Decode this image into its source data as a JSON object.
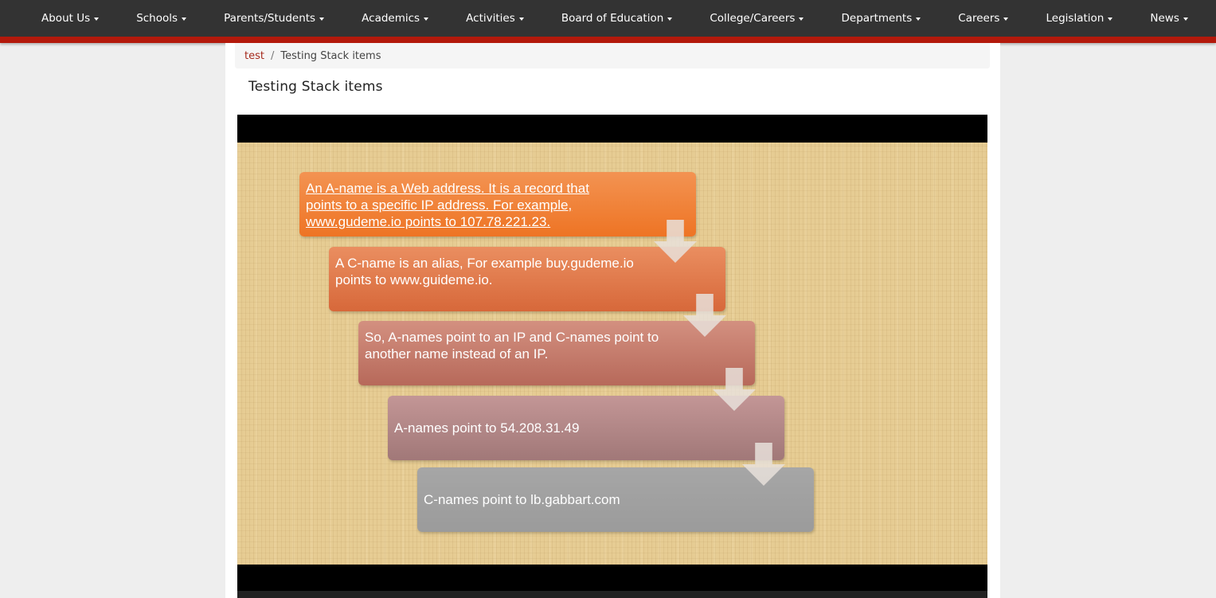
{
  "nav": {
    "items": [
      {
        "label": "About Us"
      },
      {
        "label": "Schools"
      },
      {
        "label": "Parents/Students"
      },
      {
        "label": "Academics"
      },
      {
        "label": "Activities"
      },
      {
        "label": "Board of Education"
      },
      {
        "label": "College/Careers"
      },
      {
        "label": "Departments"
      },
      {
        "label": "Careers"
      },
      {
        "label": "Legislation"
      },
      {
        "label": "News"
      }
    ]
  },
  "breadcrumb": {
    "link": "test",
    "separator": "/",
    "current": "Testing Stack items"
  },
  "page": {
    "title": "Testing Stack items"
  },
  "slide": {
    "steps": [
      {
        "text": "An A-name is a Web address. It is a record that points to a specific IP address. For example, www.gudeme.io points to 107.78.221.23."
      },
      {
        "text": "A C-name is an alias, For example buy.gudeme.io points to www.guideme.io."
      },
      {
        "text": "So, A-names point to an IP and C-names point to another name instead of an IP."
      },
      {
        "text": "A-names point to 54.208.31.49"
      },
      {
        "text": "C-names point to lb.gabbart.com"
      }
    ]
  },
  "colors": {
    "nav_bg": "#333333",
    "nav_accent": "#b3190b",
    "link": "#a52a1d"
  }
}
